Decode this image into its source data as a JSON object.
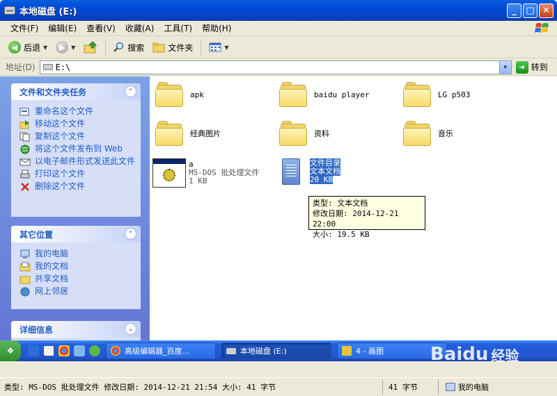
{
  "window": {
    "title": "本地磁盘 (E:)",
    "buttons": {
      "minimize": "_",
      "maximize": "□",
      "close": "✕"
    }
  },
  "menu": [
    "文件(F)",
    "编辑(E)",
    "查看(V)",
    "收藏(A)",
    "工具(T)",
    "帮助(H)"
  ],
  "toolbar": {
    "back": "后退",
    "search": "搜索",
    "folders": "文件夹"
  },
  "address": {
    "label": "地址(D)",
    "value": "E:\\",
    "go": "转到"
  },
  "panels": {
    "tasks": {
      "title": "文件和文件夹任务",
      "items": [
        "重命名这个文件",
        "移动这个文件",
        "复制这个文件",
        "将这个文件发布到 Web",
        "以电子邮件形式发送此文件",
        "打印这个文件",
        "删除这个文件"
      ]
    },
    "places": {
      "title": "其它位置",
      "items": [
        "我的电脑",
        "我的文档",
        "共享文档",
        "网上邻居"
      ]
    },
    "details": {
      "title": "详细信息"
    }
  },
  "files": {
    "folders": [
      "apk",
      "baidu player",
      "LG p503",
      "经典图片",
      "资料",
      "音乐"
    ],
    "bat": {
      "name": "a",
      "type": "MS-DOS 批处理文件",
      "size": "1 KB"
    },
    "txt": {
      "name": "文件目录",
      "type": "文本文档",
      "size": "20 KB"
    }
  },
  "tooltip": {
    "line1": "类型: 文本文档",
    "line2": "修改日期: 2014-12-21 22:00",
    "line3": "大小: 19.5 KB"
  },
  "taskbar": {
    "start": "开始",
    "buttons": [
      "高级编辑器_百度...",
      "本地磁盘 (E:)",
      "4 - 画图"
    ]
  },
  "status": {
    "left": "类型: MS-DOS 批处理文件 修改日期: 2014-12-21 21:54 大小: 41 字节",
    "mid": "41 字节",
    "right": "我的电脑"
  },
  "watermark": {
    "brand": "Baidu",
    "cn": "经验"
  }
}
